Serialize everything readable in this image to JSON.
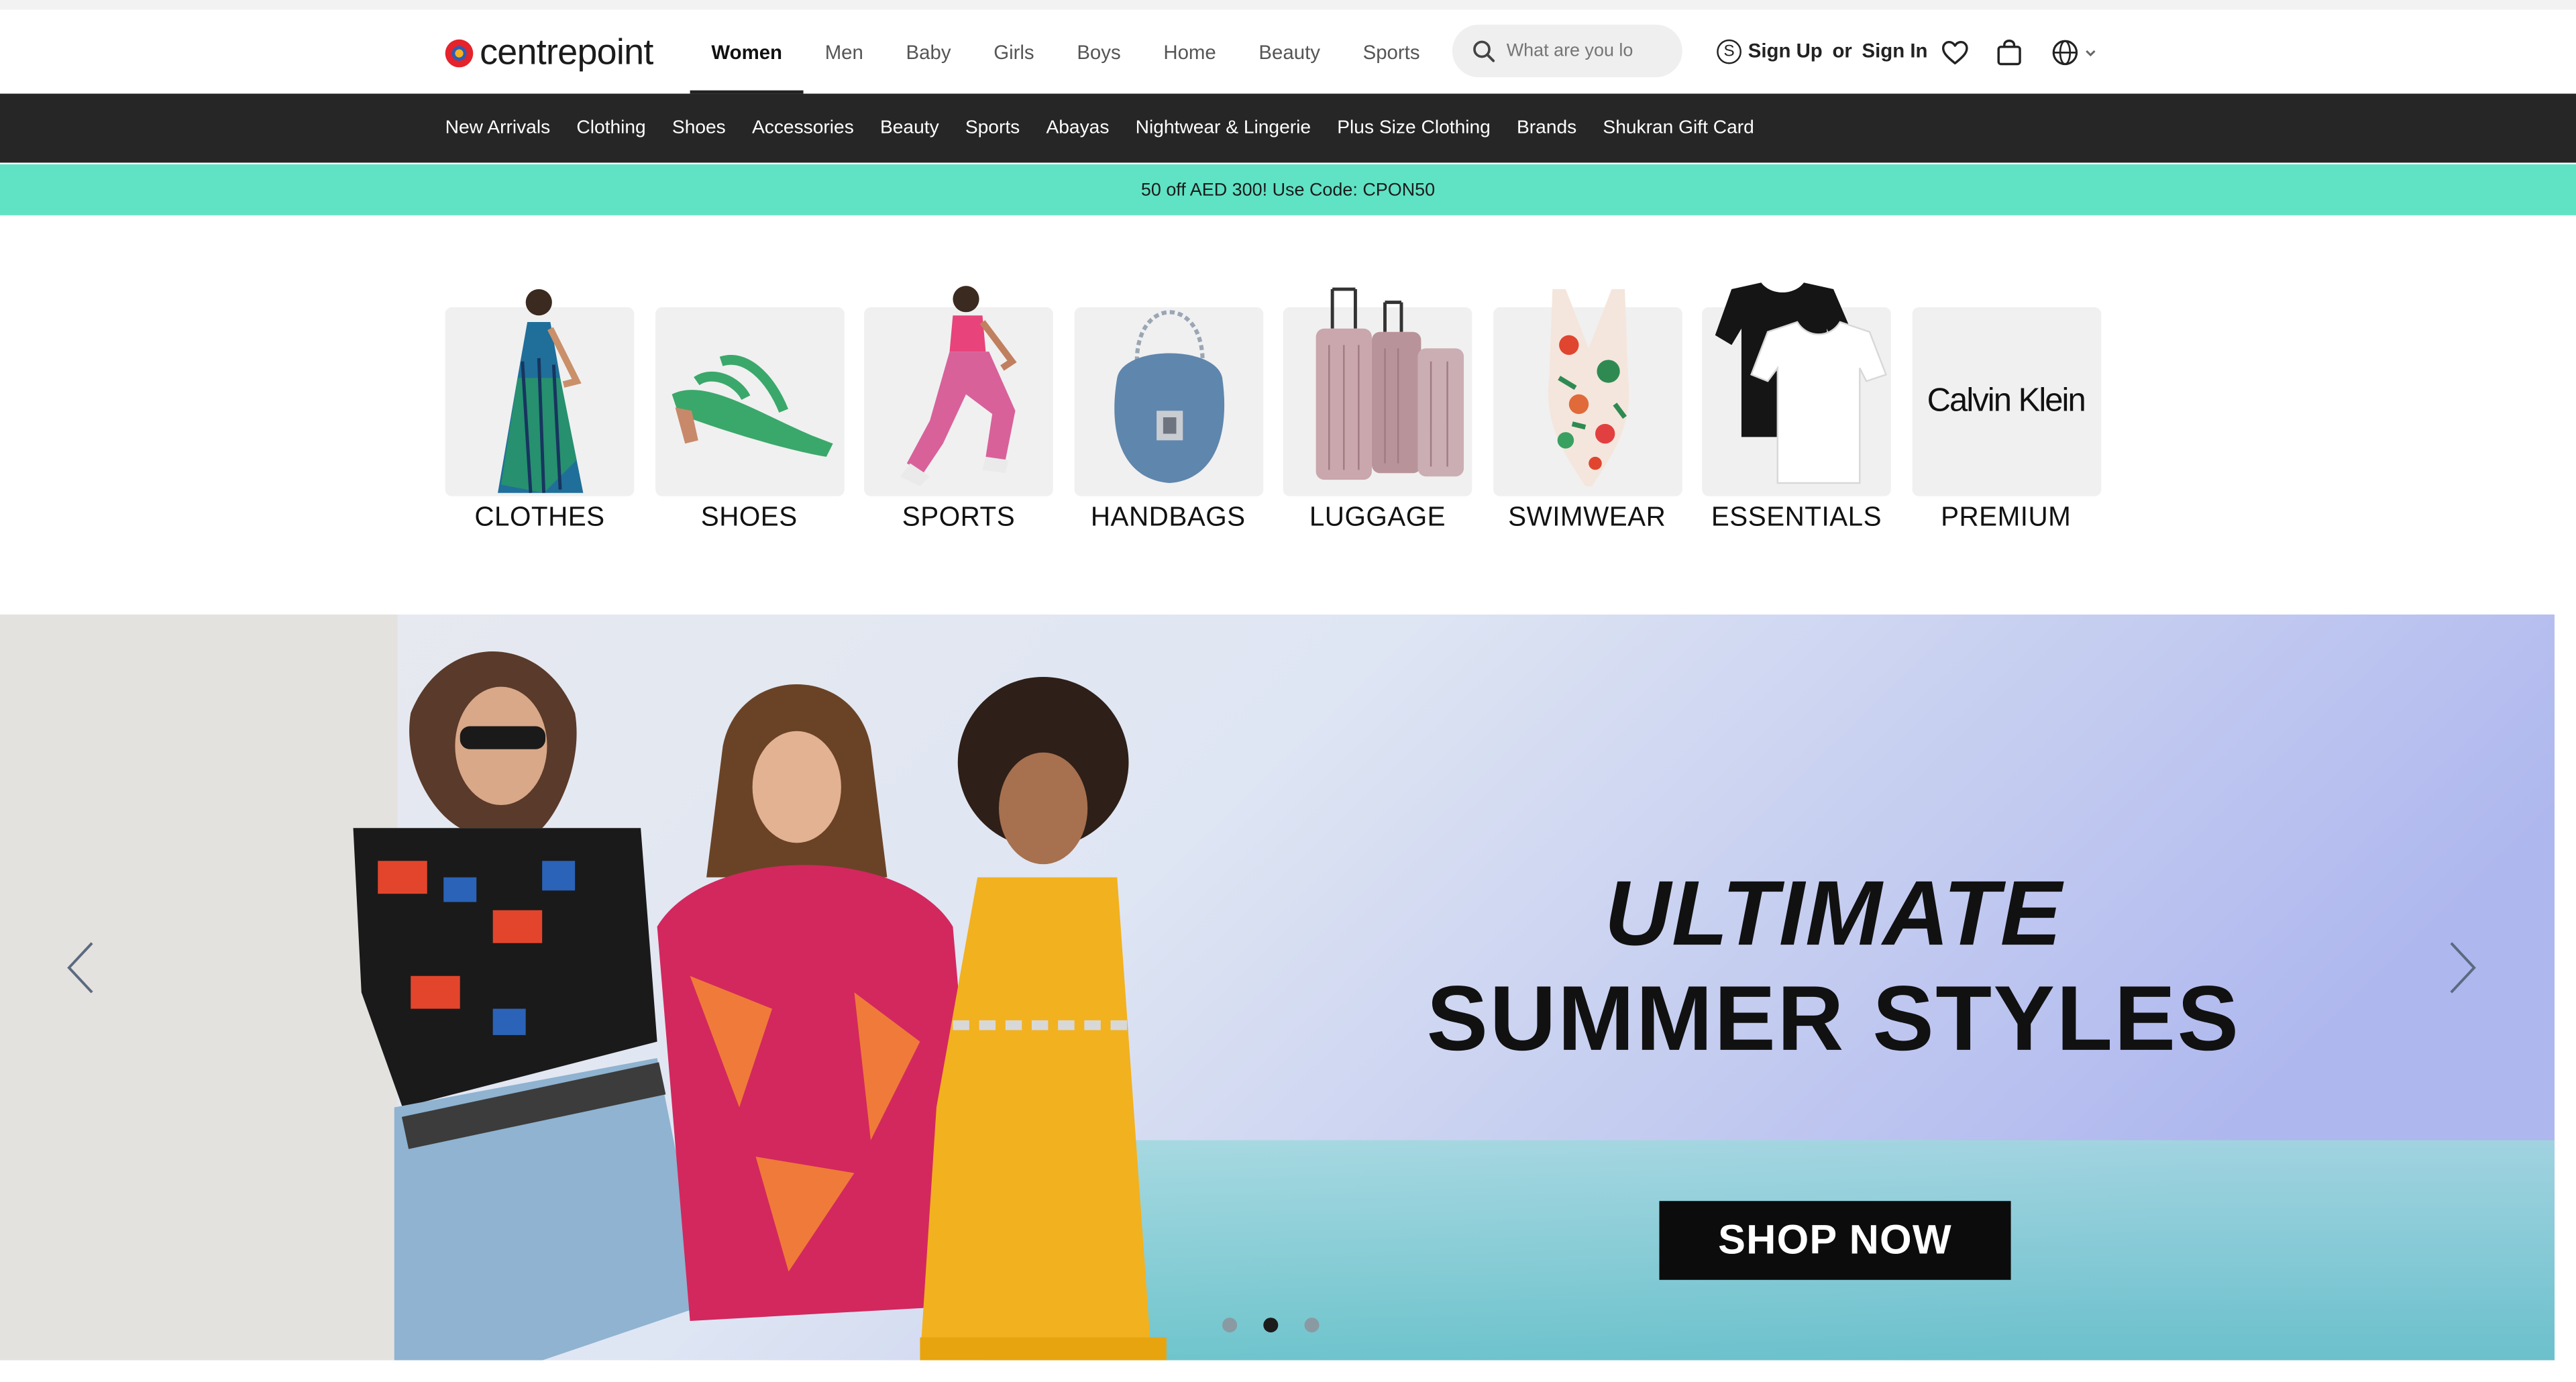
{
  "logo": {
    "text": "centrepoint"
  },
  "main_nav": [
    "Women",
    "Men",
    "Baby",
    "Girls",
    "Boys",
    "Home",
    "Beauty",
    "Sports"
  ],
  "main_nav_active": "Women",
  "search": {
    "placeholder": "What are you lo"
  },
  "account": {
    "sign_up": "Sign Up",
    "or": "or",
    "sign_in": "Sign In",
    "coin_symbol": "S"
  },
  "icons": [
    "search-icon",
    "shukran-coin-icon",
    "heart-icon",
    "bag-icon",
    "globe-icon",
    "chevron-down-icon",
    "chevron-left-icon",
    "chevron-right-icon"
  ],
  "subnav": [
    "New Arrivals",
    "Clothing",
    "Shoes",
    "Accessories",
    "Beauty",
    "Sports",
    "Abayas",
    "Nightwear & Lingerie",
    "Plus Size Clothing",
    "Brands",
    "Shukran Gift Card"
  ],
  "promo": {
    "text": "50 off AED 300! Use Code: CPON50",
    "color": "#5fe3c4"
  },
  "categories": [
    {
      "label": "CLOTHES"
    },
    {
      "label": "SHOES"
    },
    {
      "label": "SPORTS"
    },
    {
      "label": "HANDBAGS"
    },
    {
      "label": "LUGGAGE"
    },
    {
      "label": "SWIMWEAR"
    },
    {
      "label": "ESSENTIALS"
    },
    {
      "label": "PREMIUM",
      "brand_text": "Calvin Klein"
    }
  ],
  "hero": {
    "title_line1": "ULTIMATE",
    "title_line2": "SUMMER STYLES",
    "cta": "SHOP NOW",
    "slide_count": 3,
    "active_slide": 2
  },
  "colors": {
    "subnav_bg": "#262626",
    "promo_bg": "#5fe3c4",
    "cta_bg": "#0c0c0c"
  }
}
